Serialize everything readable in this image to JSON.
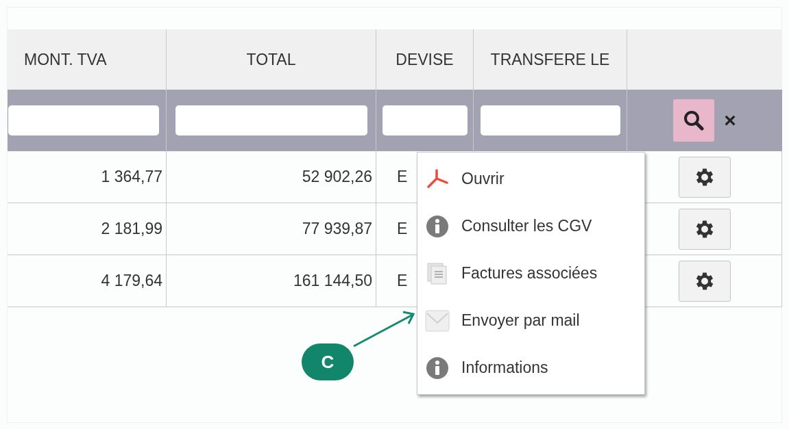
{
  "table": {
    "columns": [
      "MONT. TVA",
      "TOTAL",
      "DEVISE",
      "TRANSFERE LE"
    ],
    "rows": [
      {
        "mont_tva": "1 364,77",
        "total": "52 902,26",
        "devise": "E"
      },
      {
        "mont_tva": "2 181,99",
        "total": "77 939,87",
        "devise": "E"
      },
      {
        "mont_tva": "4 179,64",
        "total": "161 144,50",
        "devise": "E"
      }
    ],
    "filter_clear": "×"
  },
  "context_menu": {
    "items": [
      {
        "label": "Ouvrir",
        "kind": "pdf"
      },
      {
        "label": "Consulter les CGV",
        "kind": "info"
      },
      {
        "label": "Factures associées",
        "kind": "documents"
      },
      {
        "label": "Envoyer par mail",
        "kind": "mail"
      },
      {
        "label": "Informations",
        "kind": "info"
      }
    ]
  },
  "callout": {
    "label": "C"
  }
}
